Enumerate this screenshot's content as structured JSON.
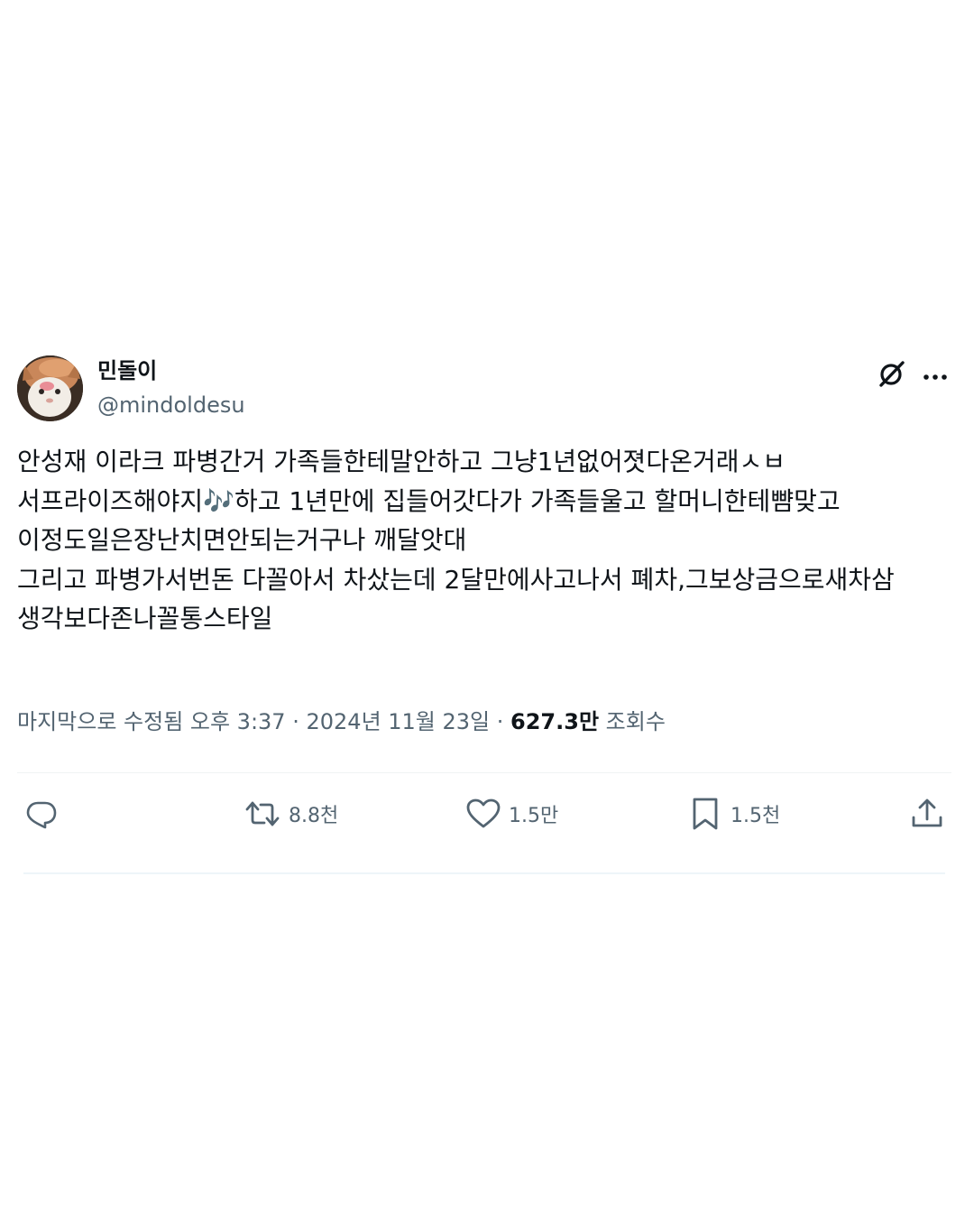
{
  "author": {
    "display_name": "민돌이",
    "handle": "@mindoldesu"
  },
  "post": {
    "text": "안성재 이라크 파병간거 가족들한테말안하고 그냥1년없어졋다온거래ㅅㅂ\n서프라이즈해야지🎶하고 1년만에 집들어갓다가 가족들울고 할머니한테뺨맞고 이정도일은장난치면안되는거구나 깨달앗대\n그리고 파병가서번돈 다꼴아서 차샀는데 2달만에사고나서 폐차,그보상금으로새차삼\n생각보다존나꼴통스타일"
  },
  "meta": {
    "edited_label": "마지막으로 수정됨 오후 3:37",
    "separator": " · ",
    "date": "2024년 11월 23일",
    "views_count": "627.3만",
    "views_label": "조회수"
  },
  "actions": {
    "reply_icon": "reply-bubble-icon",
    "retweet_count": "8.8천",
    "like_count": "1.5만",
    "bookmark_count": "1.5천",
    "share_icon": "share-upload-icon"
  },
  "icons": {
    "grok": "grok-slash-icon",
    "more": "more-dots-icon"
  },
  "colors": {
    "text_primary": "#0f1419",
    "text_secondary": "#536471",
    "divider": "#eff3f4"
  }
}
